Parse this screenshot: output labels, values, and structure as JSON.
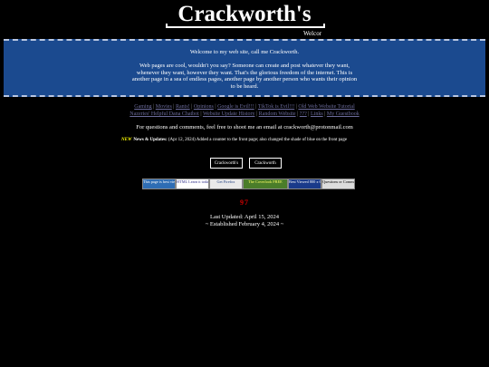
{
  "header": {
    "title": "Crackworth's",
    "marquee": "Welcor"
  },
  "banner": {
    "welcome": "Welcome to my web site, call me Crackworth.",
    "blurb": [
      "Web pages are cool, wouldn't you say? Someone can create and post whatever they want,",
      "whenever they want, however they want. That's the glorious freedom of the internet. This is",
      "another page in a sea of endless pages, another page by another person who wants their opinion",
      "to be heard."
    ]
  },
  "nav": {
    "row1": [
      "Gaming",
      "Movies",
      "Rants!",
      "Opinions",
      "Google is Evil!!!",
      "TikTok is Evil!!!",
      "Old Web Website Tutorial"
    ],
    "row2": [
      "Nazeries' Helpful Dana Chatbot",
      "Website Update History",
      "Random Website",
      "???",
      "Links",
      "My Guestbook"
    ]
  },
  "contact": "For questions and comments, feel free to shoot me an email at crackworth@protonmail.com",
  "news": {
    "badge": "NEW",
    "label": "News & Updates:",
    "text": "(Apr 12, 2024) Added a counter to the front page; also changed the shade of blue on the front page"
  },
  "buttons": [
    "Crackworth's",
    "Crackworth"
  ],
  "badges": [
    {
      "text": "This page is best viewed with",
      "bg": "#2e6db4",
      "fg": "#ffffff"
    },
    {
      "text": "HTML Learn it today!",
      "bg": "#ffffff",
      "fg": "#2e2e8a"
    },
    {
      "text": "Get Firefox",
      "bg": "#e9e9e9",
      "fg": "#204080"
    },
    {
      "text": "The Coverlook FREE",
      "bg": "#4a7d2a",
      "fg": "#ffff66"
    },
    {
      "text": "Best Viewed 800 x 600",
      "bg": "#1a3a8a",
      "fg": "#ffffff"
    },
    {
      "text": "Questions or Comments?!",
      "bg": "#dddddd",
      "fg": "#000000"
    }
  ],
  "counter": "97",
  "footer": {
    "updated": "Last Updated: April 15, 2024",
    "established": "~ Established February 4, 2024 ~"
  }
}
